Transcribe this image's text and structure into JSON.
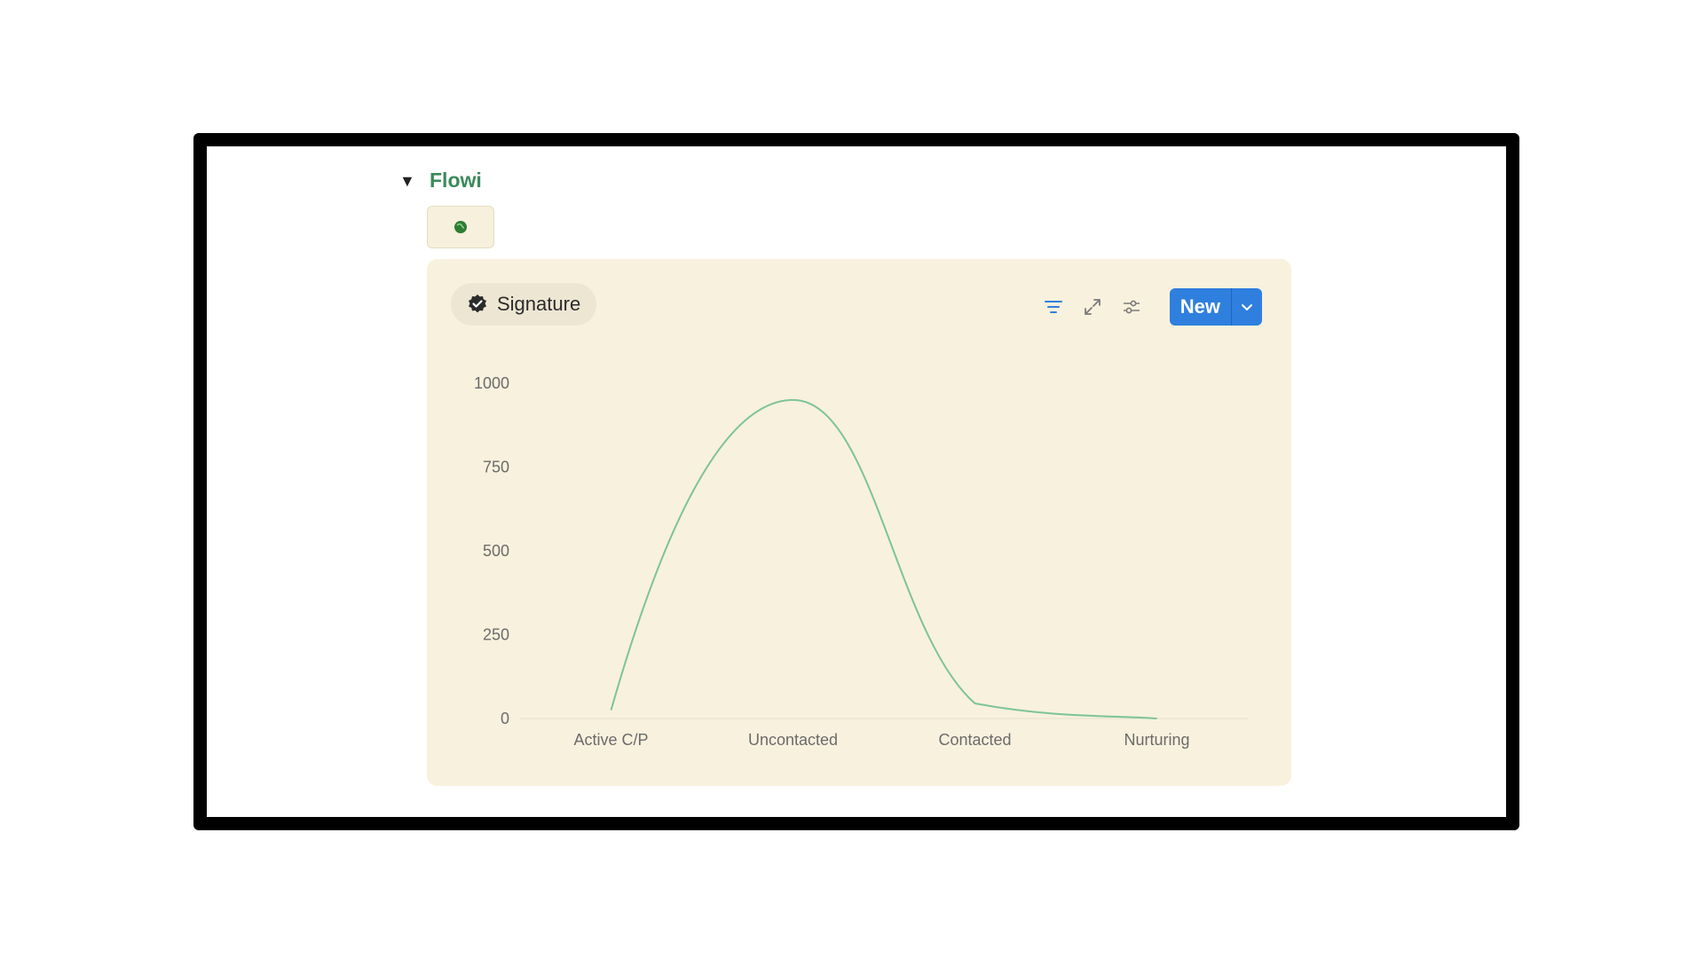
{
  "toggle": {
    "arrow": "▼",
    "title": "Flowi"
  },
  "icon_tile": {
    "icon": "green-globe-icon",
    "color": "#2e7d32"
  },
  "view_tab": {
    "icon": "verified-badge-icon",
    "label": "Signature"
  },
  "toolbar": {
    "filter_icon": "filter-icon",
    "expand_icon": "expand-icon",
    "settings_icon": "sliders-icon",
    "new_label": "New",
    "new_caret_icon": "chevron-down-icon",
    "accent": "#2f7fde"
  },
  "chart_data": {
    "type": "line",
    "smooth": true,
    "categories": [
      "Active C/P",
      "Uncontacted",
      "Contacted",
      "Nurturing"
    ],
    "values": [
      25,
      950,
      45,
      0
    ],
    "y_ticks": [
      "1000",
      "750",
      "500",
      "250",
      "0"
    ],
    "ylim": [
      0,
      1000
    ],
    "line_color": "#7cc496",
    "grid": false
  }
}
